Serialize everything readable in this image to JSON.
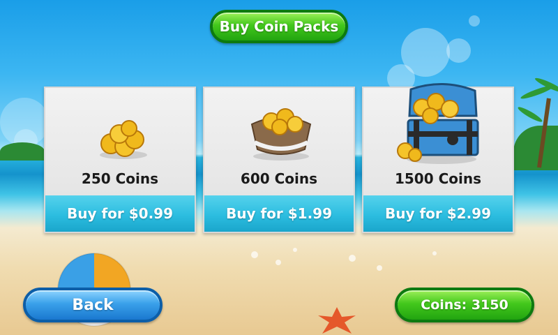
{
  "header": {
    "title": "Buy Coin Packs"
  },
  "packs": [
    {
      "coins_label": "250 Coins",
      "buy_label": "Buy for $0.99",
      "icon": "coin-pile-icon"
    },
    {
      "coins_label": "600 Coins",
      "buy_label": "Buy for $1.99",
      "icon": "coin-sack-icon"
    },
    {
      "coins_label": "1500 Coins",
      "buy_label": "Buy for $2.99",
      "icon": "treasure-chest-icon"
    }
  ],
  "footer": {
    "back_label": "Back",
    "coins_balance": "Coins: 3150"
  },
  "colors": {
    "green_button": "#3fc41a",
    "blue_button": "#2b8fe0",
    "buy_strip": "#2cbde0"
  }
}
